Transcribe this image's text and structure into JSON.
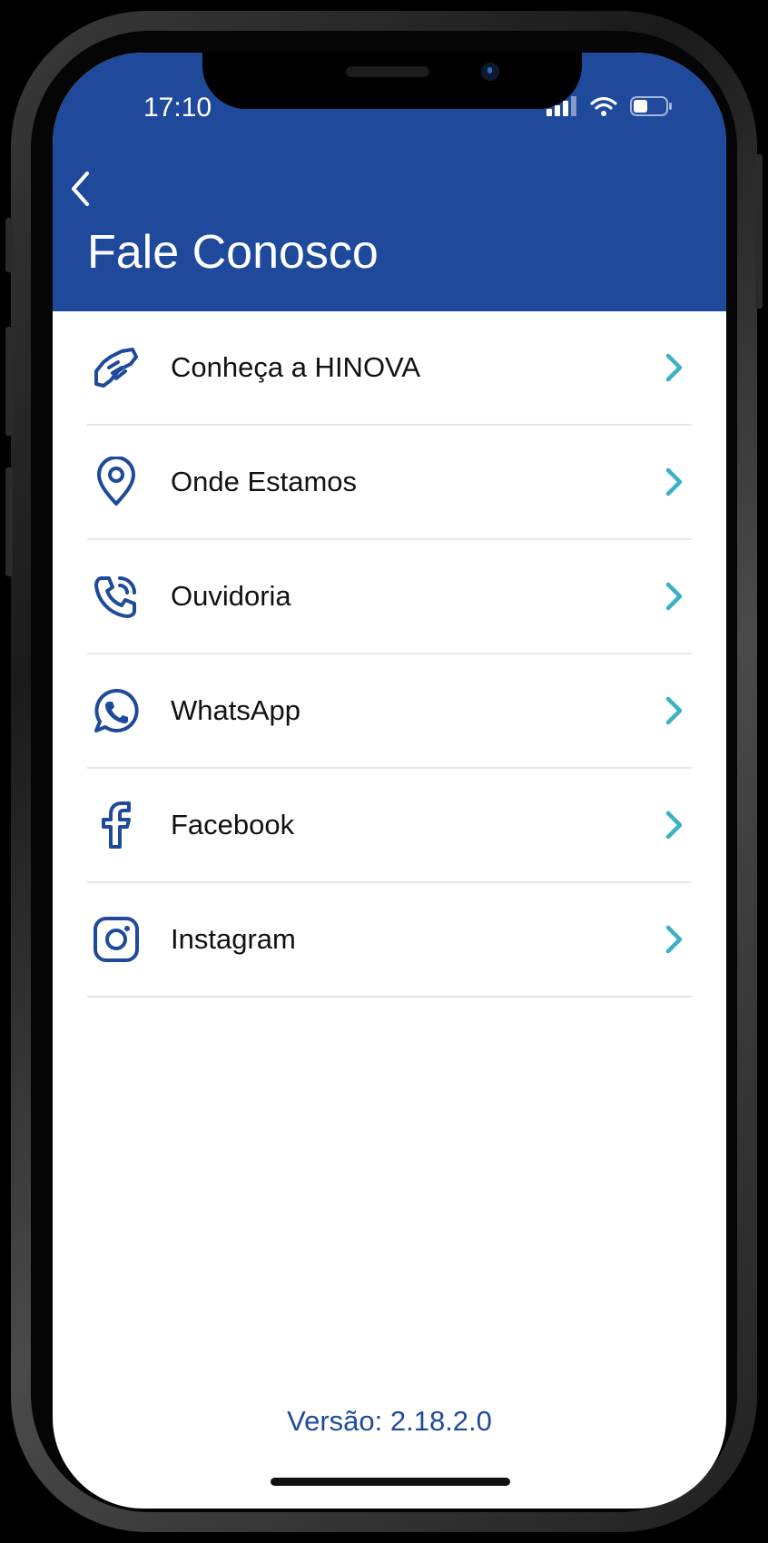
{
  "status_bar": {
    "time": "17:10"
  },
  "header": {
    "title": "Fale Conosco"
  },
  "menu": {
    "items": [
      {
        "label": "Conheça a HINOVA",
        "icon": "handshake-icon"
      },
      {
        "label": "Onde Estamos",
        "icon": "location-pin-icon"
      },
      {
        "label": "Ouvidoria",
        "icon": "phone-call-icon"
      },
      {
        "label": "WhatsApp",
        "icon": "whatsapp-icon"
      },
      {
        "label": "Facebook",
        "icon": "facebook-icon"
      },
      {
        "label": "Instagram",
        "icon": "instagram-icon"
      }
    ]
  },
  "footer": {
    "version": "Versão: 2.18.2.0"
  },
  "colors": {
    "brand": "#1f4a9c",
    "chevron": "#3bb1c6",
    "divider": "#e6e6e6"
  }
}
